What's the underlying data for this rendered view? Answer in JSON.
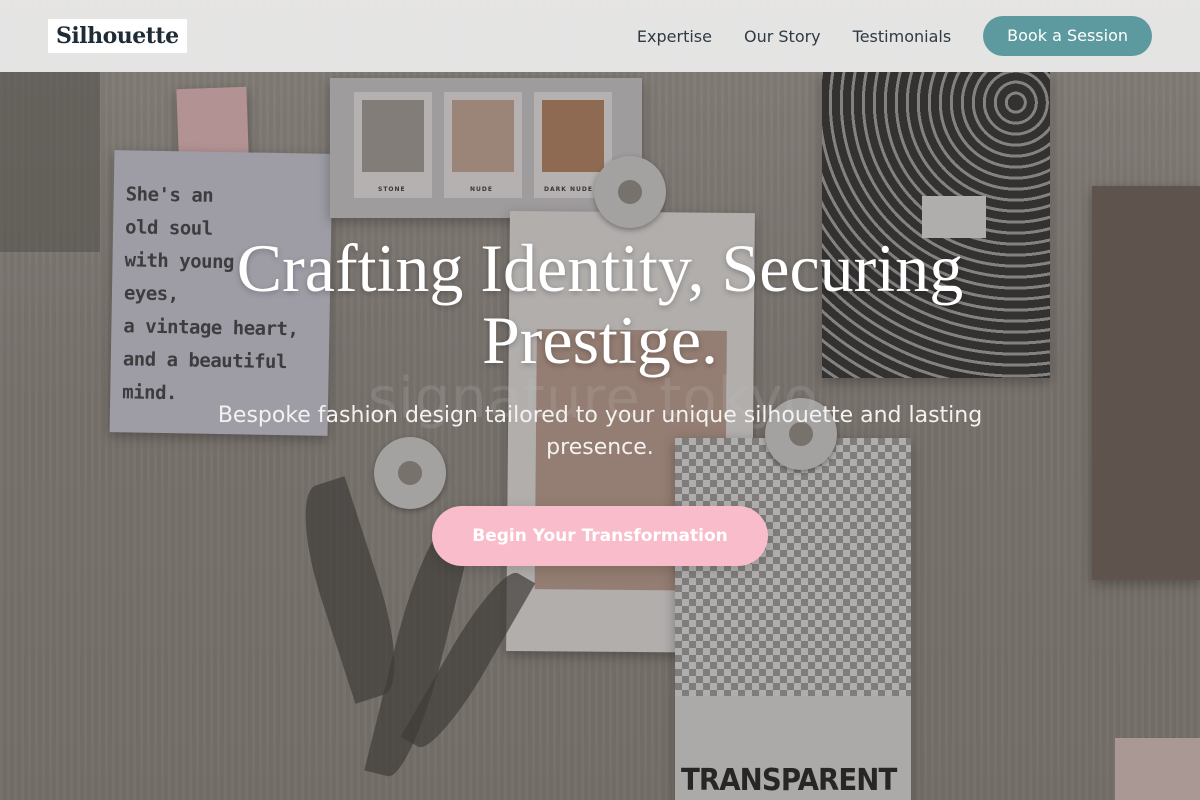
{
  "brand": {
    "logo_text": "Silhouette"
  },
  "nav": {
    "links": [
      "Expertise",
      "Our Story",
      "Testimonials"
    ],
    "cta_label": "Book a Session",
    "cta_color": "#5d9a9f"
  },
  "hero": {
    "title": "Crafting Identity, Securing Prestige.",
    "subtitle": "Bespoke fashion design tailored to your unique silhouette and lasting presence.",
    "cta_label": "Begin Your Transformation",
    "cta_color": "#f8bccb",
    "background": {
      "quote_card_text": "She's an\nold soul\nwith young\neyes,\na vintage heart,\nand a beautiful\nmind.",
      "swatch_labels": [
        "STONE",
        "NUDE",
        "DARK NUDE"
      ],
      "swatch_colors": [
        "#a09a96",
        "#c2a594",
        "#b07e5c"
      ],
      "checker_card_label": "TRANSPARENT",
      "watermark_text": "signature tokyo"
    }
  }
}
